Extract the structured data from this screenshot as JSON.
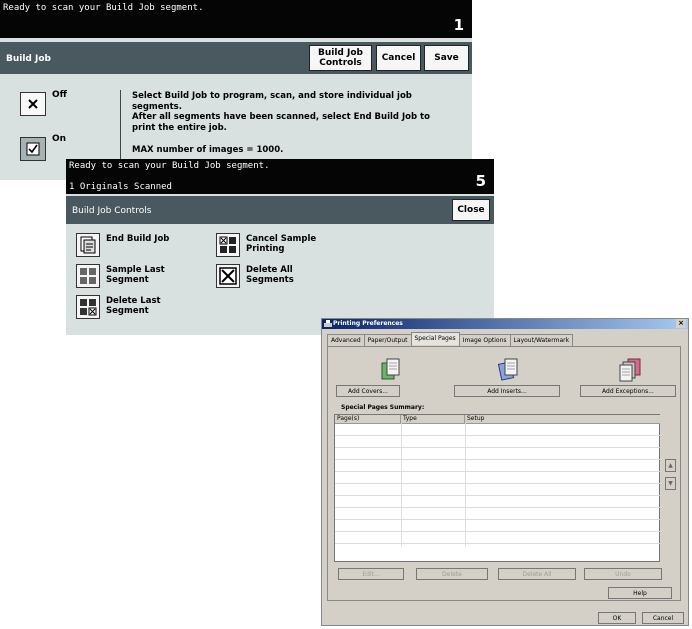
{
  "panel1": {
    "header_message": "Ready to scan your Build Job segment.",
    "screen_number": "1",
    "title": "Build Job",
    "buttons": {
      "controls": "Build Job Controls",
      "cancel": "Cancel",
      "save": "Save"
    },
    "options": {
      "off": "Off",
      "on": "On"
    },
    "selected": "On",
    "description": [
      "Select Build Job to program, scan, and store individual job segments.",
      "After all segments have been scanned, select End Build Job to print the entire job.",
      "MAX number of images = 1000."
    ]
  },
  "panel2": {
    "header_message": "Ready to scan your Build Job segment.",
    "status": "1 Originals Scanned",
    "screen_number": "5",
    "title": "Build Job Controls",
    "close": "Close",
    "items": [
      {
        "label": "End Build Job",
        "icon": "end-build-job-icon"
      },
      {
        "label": "Sample Last Segment",
        "icon": "sample-last-segment-icon"
      },
      {
        "label": "Delete Last Segment",
        "icon": "delete-last-segment-icon"
      },
      {
        "label": "Cancel Sample Printing",
        "icon": "cancel-sample-printing-icon"
      },
      {
        "label": "Delete All Segments",
        "icon": "delete-all-segments-icon"
      }
    ]
  },
  "panel3": {
    "window_title": "Printing Preferences",
    "tabs": [
      "Advanced",
      "Paper/Output",
      "Special Pages",
      "Image Options",
      "Layout/Watermark"
    ],
    "active_tab": "Special Pages",
    "add_buttons": [
      "Add Covers...",
      "Add Inserts...",
      "Add Exceptions..."
    ],
    "summary_label": "Special Pages Summary:",
    "columns": [
      "Page(s)",
      "Type",
      "Setup"
    ],
    "action_buttons": [
      "Edit...",
      "Delete",
      "Delete All",
      "Undo"
    ],
    "help": "Help",
    "ok": "OK",
    "cancel": "Cancel",
    "colors": {
      "titlebar": "#0a246a",
      "dialog_bg": "#d4d0c8"
    }
  }
}
